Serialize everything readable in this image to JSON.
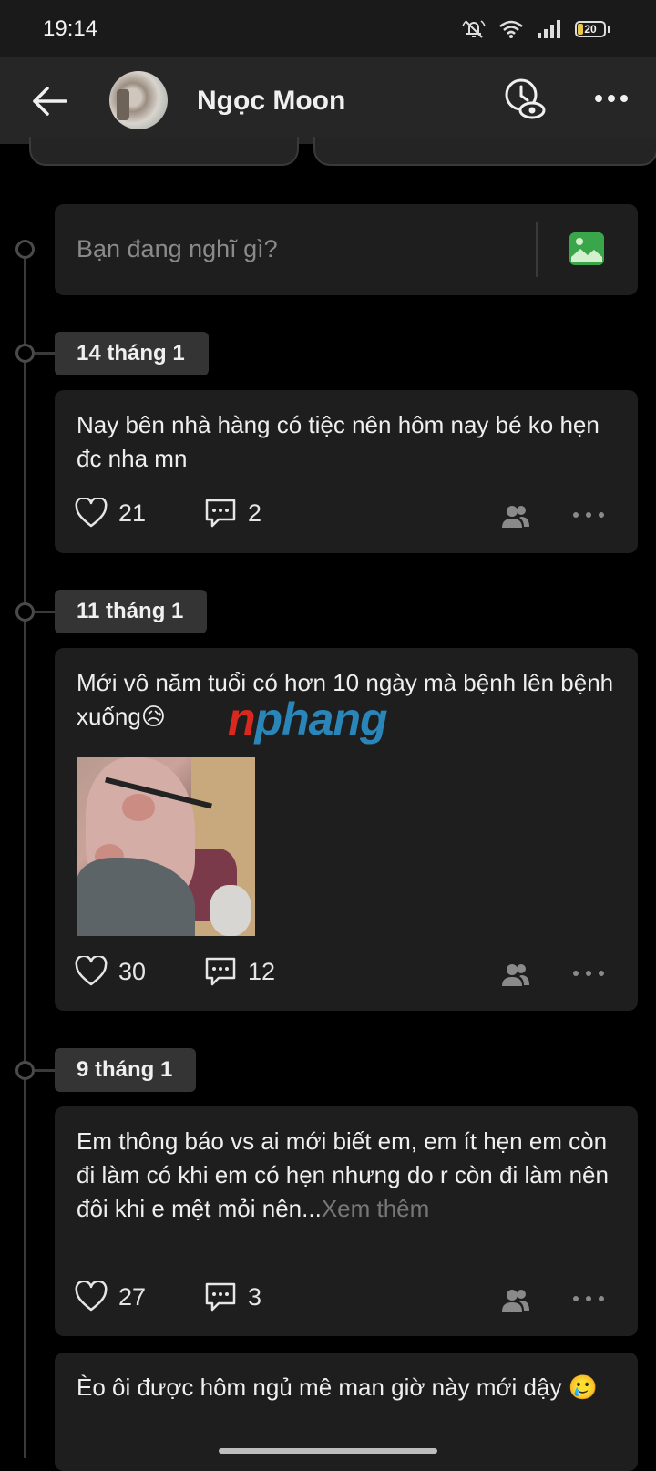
{
  "status_bar": {
    "time": "19:14",
    "battery": "20"
  },
  "header": {
    "name": "Ngọc Moon"
  },
  "composer": {
    "placeholder": "Bạn đang nghĩ gì?"
  },
  "posts": [
    {
      "date": "14 tháng 1",
      "text": "Nay bên nhà hàng có tiệc nên hôm nay bé ko hẹn đc nha mn",
      "likes": "21",
      "comments": "2"
    },
    {
      "date": "11 tháng 1",
      "text": "Mới vô năm tuổi có hơn 10 ngày mà bệnh lên bệnh xuống",
      "emoji": "😥",
      "likes": "30",
      "comments": "12"
    },
    {
      "date": "9 tháng 1",
      "text": "Em thông báo vs ai mới biết em, em ít hẹn em còn đi làm có khi em có hẹn nhưng do r còn đi làm nên đôi khi e mệt mỏi nên...",
      "see_more": "Xem thêm",
      "likes": "27",
      "comments": "3"
    },
    {
      "text": "Èo ôi được hôm ngủ mê man giờ này mới dậy",
      "emoji": "🥲"
    }
  ],
  "watermark": {
    "part1": "n",
    "part2": "phang"
  }
}
